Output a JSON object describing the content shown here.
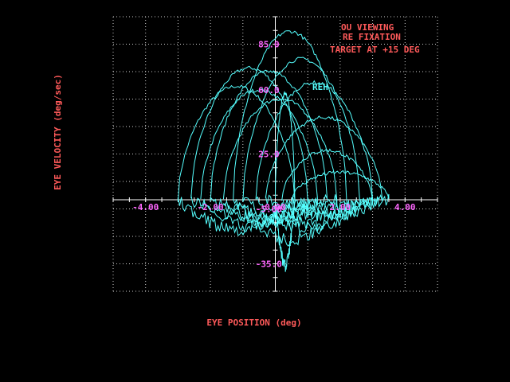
{
  "chart_data": {
    "type": "line",
    "xlabel": "EYE POSITION (deg)",
    "ylabel": "EYE VELOCITY (deg/sec)",
    "xlim": [
      -5,
      5
    ],
    "ylim": [
      -50,
      100
    ],
    "grid": true,
    "x_tick_labels": [
      {
        "value": -4,
        "label": "-4.00"
      },
      {
        "value": -2,
        "label": "-2.00"
      },
      {
        "value": 0,
        "label": "0.00"
      },
      {
        "value": 2,
        "label": "2.00"
      },
      {
        "value": 4,
        "label": "4.00"
      }
    ],
    "y_tick_labels": [
      {
        "value": 85,
        "label": "85.0"
      },
      {
        "value": 60,
        "label": "60.0"
      },
      {
        "value": 25,
        "label": "25.0"
      },
      {
        "value": -5,
        "label": "-5.00"
      },
      {
        "value": -35,
        "label": "-35.0"
      }
    ],
    "annotations": [
      "OU VIEWING",
      "RE FIXATION",
      "TARGET AT +15 DEG"
    ],
    "series": [
      {
        "name": "REH",
        "color": "#55ffff",
        "loops": [
          {
            "x0": -3.0,
            "x1": 0.6,
            "peak": 62,
            "trough": -16
          },
          {
            "x0": -2.6,
            "x1": 1.0,
            "peak": 72,
            "trough": -14
          },
          {
            "x0": -2.3,
            "x1": 1.3,
            "peak": 60,
            "trough": -12
          },
          {
            "x0": -2.0,
            "x1": 1.6,
            "peak": 70,
            "trough": -11
          },
          {
            "x0": -1.6,
            "x1": 1.9,
            "peak": 55,
            "trough": -10
          },
          {
            "x0": -1.3,
            "x1": 2.2,
            "peak": 92,
            "trough": -22
          },
          {
            "x0": -1.0,
            "x1": 2.6,
            "peak": 77,
            "trough": -15
          },
          {
            "x0": -0.6,
            "x1": 3.0,
            "peak": 64,
            "trough": -14
          },
          {
            "x0": -0.3,
            "x1": 3.3,
            "peak": 45,
            "trough": -9
          },
          {
            "x0": 0.0,
            "x1": 0.6,
            "peak": 58,
            "trough": -36
          },
          {
            "x0": 0.2,
            "x1": 3.0,
            "peak": 27,
            "trough": -8
          },
          {
            "x0": 0.5,
            "x1": 3.5,
            "peak": 15,
            "trough": -4
          }
        ]
      }
    ]
  }
}
